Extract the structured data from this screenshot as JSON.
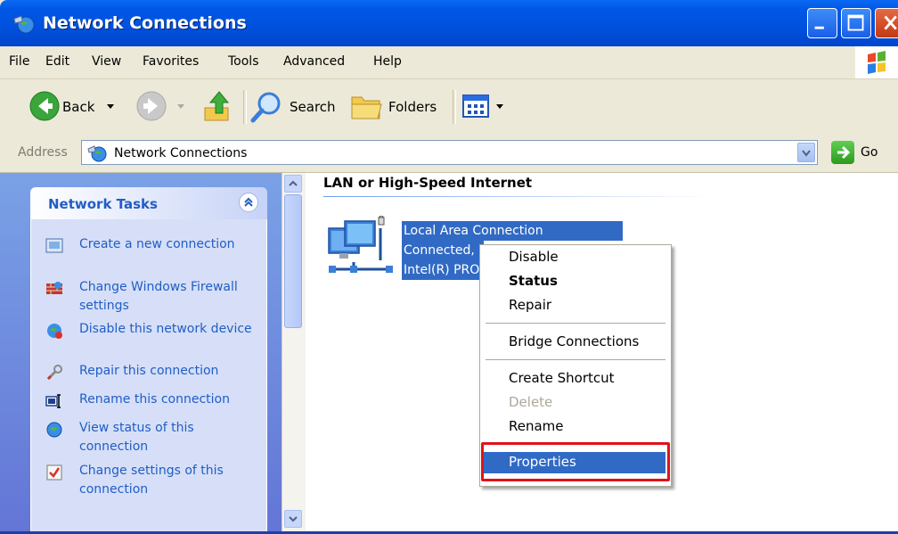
{
  "window": {
    "title": "Network Connections"
  },
  "menu": [
    "File",
    "Edit",
    "View",
    "Favorites",
    "Tools",
    "Advanced",
    "Help"
  ],
  "toolbar": {
    "back_label": "Back",
    "search_label": "Search",
    "folders_label": "Folders"
  },
  "address": {
    "label": "Address",
    "value": "Network Connections",
    "go_label": "Go"
  },
  "tasks": {
    "title": "Network Tasks",
    "items": [
      {
        "label": "Create a new connection",
        "icon": "new-connection-icon"
      },
      {
        "label": "Change Windows Firewall settings",
        "icon": "firewall-icon"
      },
      {
        "label": "Disable this network device",
        "icon": "disable-device-icon"
      },
      {
        "label": "Repair this connection",
        "icon": "repair-icon"
      },
      {
        "label": "Rename this connection",
        "icon": "rename-icon"
      },
      {
        "label": "View status of this connection",
        "icon": "status-icon"
      },
      {
        "label": "Change settings of this connection",
        "icon": "settings-icon"
      }
    ]
  },
  "content": {
    "group_title": "LAN or High-Speed Internet",
    "connection": {
      "name": "Local Area Connection",
      "status": "Connected,",
      "device": "Intel(R) PRO"
    }
  },
  "context_menu": {
    "items": [
      {
        "label": "Disable",
        "style": "normal"
      },
      {
        "label": "Status",
        "style": "bold"
      },
      {
        "label": "Repair",
        "style": "normal"
      },
      {
        "label": "Bridge Connections",
        "style": "normal"
      },
      {
        "label": "Create Shortcut",
        "style": "normal"
      },
      {
        "label": "Delete",
        "style": "disabled"
      },
      {
        "label": "Rename",
        "style": "normal"
      },
      {
        "label": "Properties",
        "style": "selected"
      }
    ]
  },
  "colors": {
    "titlebar": "#0054e3",
    "selection": "#316ac5",
    "task_link": "#215dc6",
    "highlight_box": "#e0121a"
  }
}
